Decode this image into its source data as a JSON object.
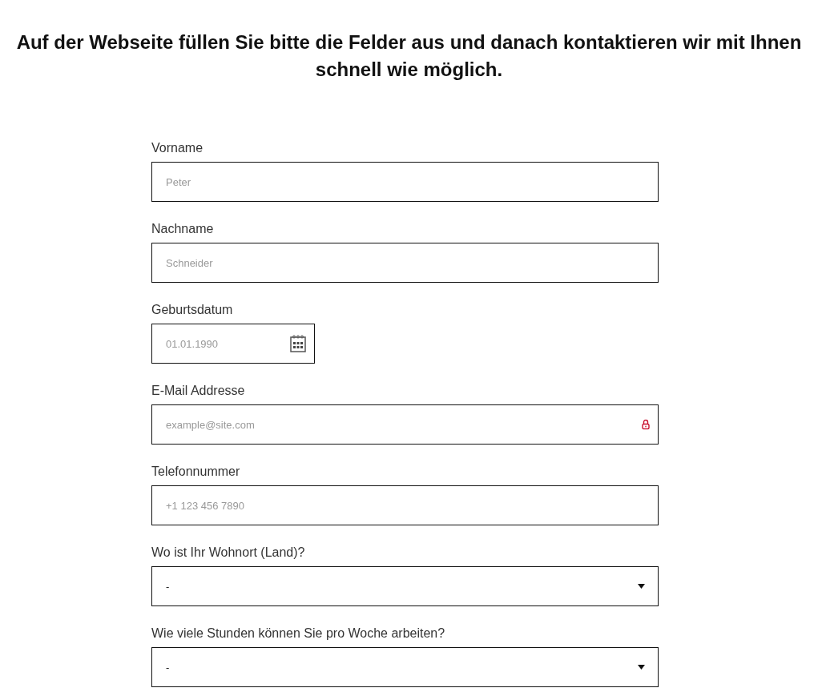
{
  "heading": "Auf der Webseite füllen Sie bitte die Felder aus und danach kontaktieren wir mit Ihnen schnell wie möglich.",
  "fields": [
    {
      "kind": "text",
      "label": "Vorname",
      "placeholder": "Peter"
    },
    {
      "kind": "text",
      "label": "Nachname",
      "placeholder": "Schneider"
    },
    {
      "kind": "date",
      "label": "Geburtsdatum",
      "placeholder": "01.01.1990"
    },
    {
      "kind": "email",
      "label": "E-Mail Addresse",
      "placeholder": "example@site.com"
    },
    {
      "kind": "text",
      "label": "Telefonnummer",
      "placeholder": "+1 123 456 7890"
    },
    {
      "kind": "select",
      "label": "Wo ist Ihr Wohnort (Land)?",
      "value": "-"
    },
    {
      "kind": "select",
      "label": "Wie viele Stunden können Sie pro Woche arbeiten?",
      "value": "-"
    }
  ]
}
